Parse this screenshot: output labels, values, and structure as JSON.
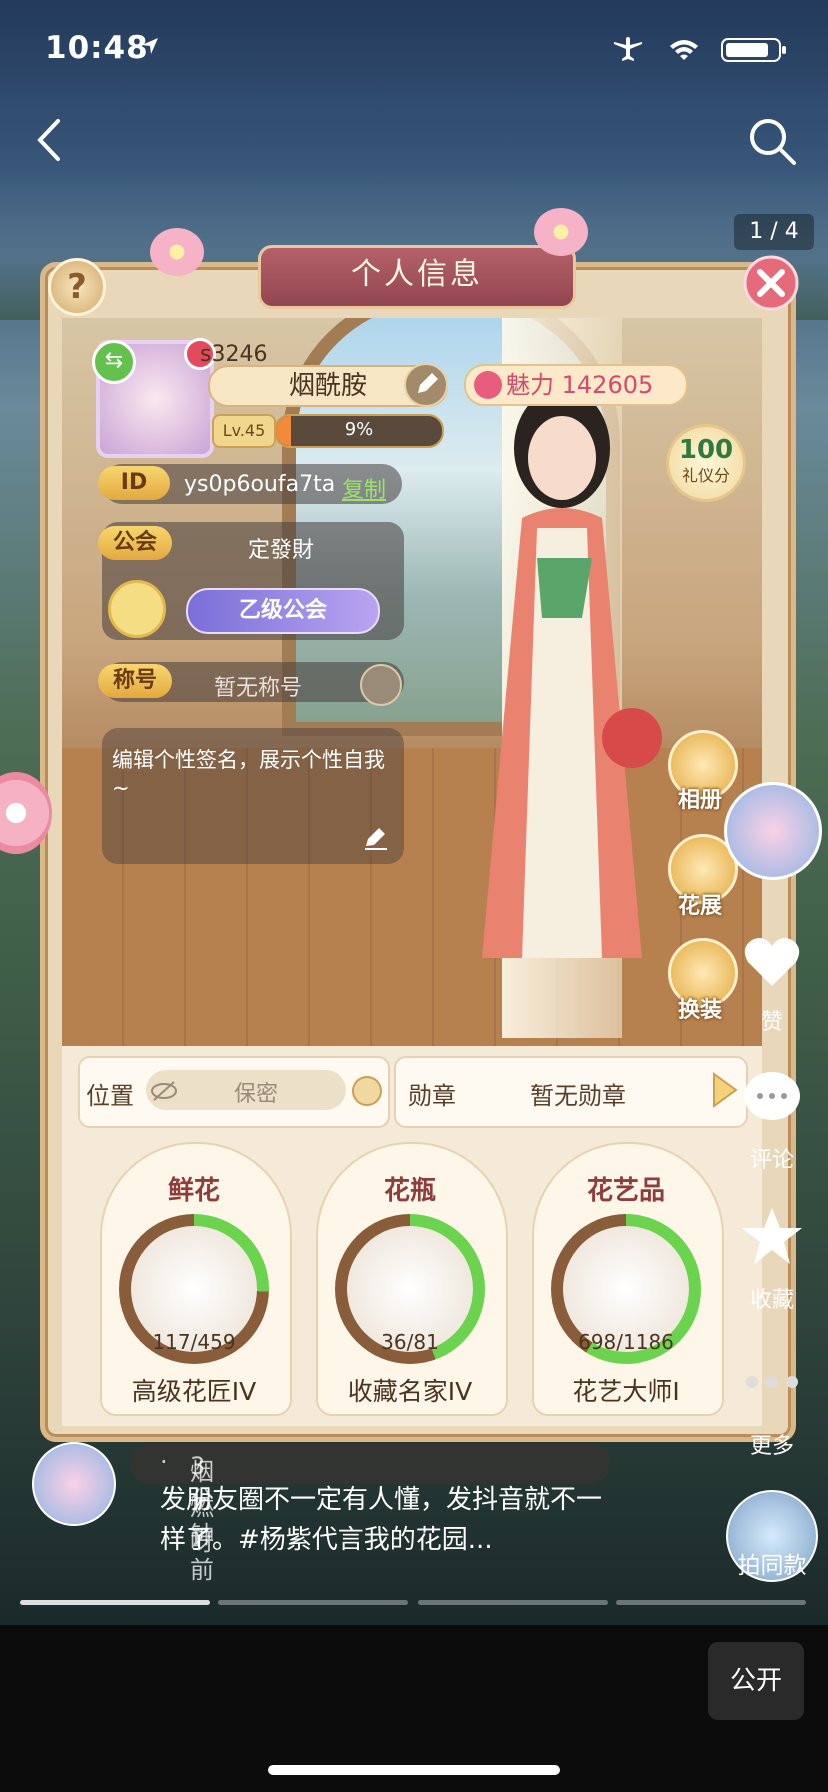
{
  "status_bar": {
    "time": "10:48"
  },
  "page": {
    "pager": "1 / 4"
  },
  "panel": {
    "title": "个人信息",
    "help": "?",
    "player": {
      "uid_fragment": "s3246",
      "name": "烟酰胺",
      "level": "Lv.45",
      "exp_percent": "9%",
      "exp_fraction": 0.09,
      "charm_label": "魅力",
      "charm_value": "142605",
      "etiquette_score": "100",
      "etiquette_label": "礼仪分"
    },
    "id_row": {
      "tag": "ID",
      "value": "ys0p6oufa7ta",
      "copy": "复制"
    },
    "guild_row": {
      "tag": "公会",
      "name": "定發財",
      "rank": "乙级公会"
    },
    "title_row": {
      "tag": "称号",
      "value": "暂无称号"
    },
    "signature": "编辑个性签名，展示个性自我~",
    "side_buttons": [
      {
        "label": "相册",
        "icon": "photo-icon"
      },
      {
        "label": "花展",
        "icon": "flower-icon"
      },
      {
        "label": "换装",
        "icon": "dress-icon"
      }
    ],
    "location": {
      "label": "位置",
      "value": "保密"
    },
    "medal": {
      "label": "勋章",
      "value": "暂无勋章"
    },
    "collections": [
      {
        "title": "鲜花",
        "count": "117/459",
        "progress": 0.255,
        "rank": "高级花匠IV",
        "icon": "bouquet-icon"
      },
      {
        "title": "花瓶",
        "count": "36/81",
        "progress": 0.444,
        "rank": "收藏名家IV",
        "icon": "vase-icon"
      },
      {
        "title": "花艺品",
        "count": "698/1186",
        "progress": 0.589,
        "rank": "花艺大师I",
        "icon": "arrangement-icon"
      }
    ]
  },
  "rail": {
    "like": "赞",
    "comment": "评论",
    "favorite": "收藏",
    "more": "更多",
    "same_style": "拍同款"
  },
  "caption": {
    "author": "烟燃呀",
    "time": "3分钟前",
    "text": "发朋友圈不一定有人懂，发抖音就不一样了。#杨紫代言我的花园..."
  },
  "bottom": {
    "public": "公开"
  },
  "colors": {
    "accent_green": "#62c24d",
    "charm_pink": "#d64a6a",
    "ring_green": "#6bd34e",
    "ring_brown": "#8a5d3a"
  }
}
